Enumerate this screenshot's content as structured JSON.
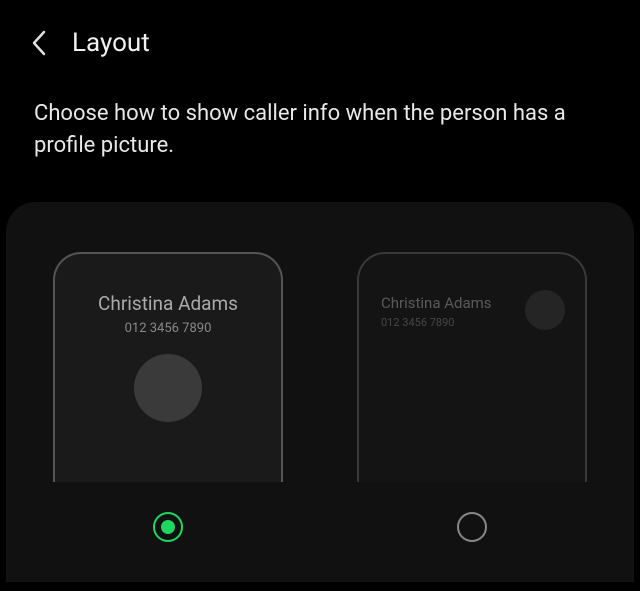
{
  "header": {
    "title": "Layout"
  },
  "description": "Choose how to show caller info when the person has a profile picture.",
  "caller": {
    "name": "Christina Adams",
    "number": "012 3456 7890"
  },
  "options": {
    "centered": {
      "selected": true
    },
    "corner": {
      "selected": false
    }
  },
  "colors": {
    "accent": "#1ed760",
    "background": "#000000",
    "panel": "#111111"
  }
}
